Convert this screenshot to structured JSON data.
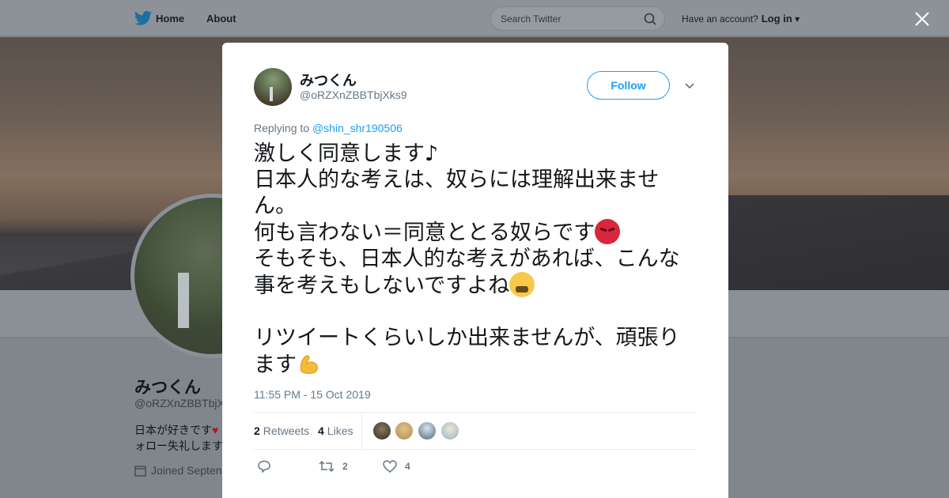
{
  "topbar": {
    "home_label": "Home",
    "about_label": "About",
    "search_placeholder": "Search Twitter",
    "account_text": "Have an account?",
    "login_label": "Log in"
  },
  "profile": {
    "name": "みつくん",
    "handle": "@oRZXnZBBTbjX",
    "bio_line1": "日本が好きです",
    "bio_line2": "ォロー失礼します",
    "joined": "Joined Septen"
  },
  "tweet": {
    "author_name": "みつくん",
    "author_handle": "@oRZXnZBBTbjXks9",
    "follow_label": "Follow",
    "replying_prefix": "Replying to",
    "replying_to": "@shin_shr190506",
    "text_line1": "激しく同意します♪",
    "text_line2": "日本人的な考えは、奴らには理解出来ませ",
    "text_line3": "ん。",
    "text_line4": "何も言わない＝同意ととる奴らです",
    "text_line5": "そもそも、日本人的な考えがあれば、こんな",
    "text_line6": "事を考えもしないですよね",
    "text_line7": "リツイートくらいしか出来ませんが、頑張り",
    "text_line8": "ます",
    "emoji_1": "pouting-face",
    "emoji_2": "tired-face",
    "emoji_3": "flexed-biceps",
    "timestamp": "11:55 PM - 15 Oct 2019",
    "retweets_count": "2",
    "retweets_label": "Retweets",
    "likes_count": "4",
    "likes_label": "Likes",
    "action_retweet_count": "2",
    "action_like_count": "4"
  },
  "colors": {
    "accent": "#1da1f2",
    "text_secondary": "#657786",
    "overlay_bg": "#7f868c"
  }
}
